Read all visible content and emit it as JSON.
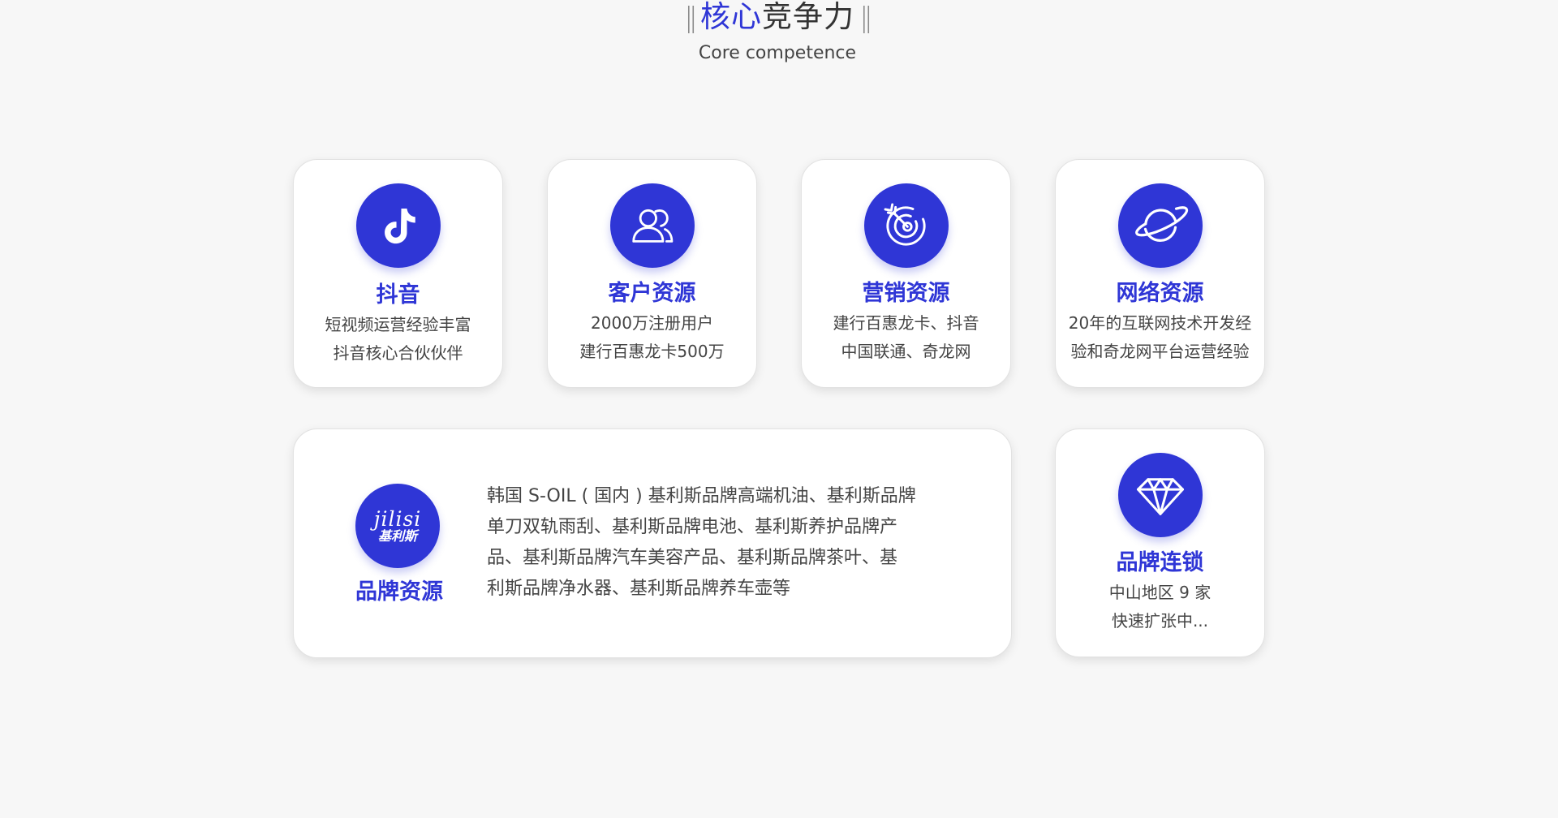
{
  "header": {
    "bars_left": "‖",
    "title_accent": "核心",
    "title_rest": "竞争力",
    "bars_right": "‖",
    "subtitle": "Core competence"
  },
  "colors": {
    "accent": "#2f36d6",
    "background": "#f7f7f7",
    "card": "#ffffff"
  },
  "cards": [
    {
      "icon": "tiktok-icon",
      "title": "抖音",
      "lines": [
        "短视频运营经验丰富",
        "抖音核心合伙伙伴"
      ]
    },
    {
      "icon": "users-icon",
      "title": "客户资源",
      "lines": [
        "2000万注册用户",
        "建行百惠龙卡500万"
      ]
    },
    {
      "icon": "target-icon",
      "title": "营销资源",
      "lines": [
        "建行百惠龙卡、抖音",
        "中国联通、奇龙网"
      ]
    },
    {
      "icon": "planet-icon",
      "title": "网络资源",
      "lines": [
        "20年的互联网技术开发经",
        "验和奇龙网平台运营经验"
      ]
    }
  ],
  "brand_card": {
    "icon": "jilisi-logo-icon",
    "logo_latin": "jilisi",
    "logo_han": "基利斯",
    "title": "品牌资源",
    "lines": [
      "韩国 S-OIL ( 国内 ) 基利斯品牌高端机油、基利斯品牌",
      "单刀双轨雨刮、基利斯品牌电池、基利斯养护品牌产",
      "品、基利斯品牌汽车美容产品、基利斯品牌茶叶、基",
      "利斯品牌净水器、基利斯品牌养车壶等"
    ]
  },
  "chain_card": {
    "icon": "diamond-icon",
    "title": "品牌连锁",
    "lines": [
      "中山地区 9 家",
      "快速扩张中..."
    ]
  }
}
